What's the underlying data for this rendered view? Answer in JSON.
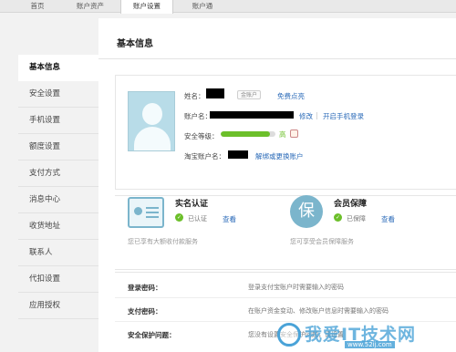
{
  "topnav": {
    "tabs": [
      {
        "label": "首页"
      },
      {
        "label": "账户资产"
      },
      {
        "label": "账户设置"
      },
      {
        "label": "账户通"
      }
    ]
  },
  "sidebar": {
    "items": [
      {
        "label": "基本信息"
      },
      {
        "label": "安全设置"
      },
      {
        "label": "手机设置"
      },
      {
        "label": "额度设置"
      },
      {
        "label": "支付方式"
      },
      {
        "label": "消息中心"
      },
      {
        "label": "收货地址"
      },
      {
        "label": "联系人"
      },
      {
        "label": "代扣设置"
      },
      {
        "label": "应用授权"
      }
    ]
  },
  "main": {
    "title": "基本信息",
    "profile": {
      "name_label": "姓名：",
      "cert_badge": "金账户",
      "free_light_link": "免费点亮",
      "account_label": "账户名：",
      "edit_link": "修改",
      "mobile_link": "开启手机登录",
      "security_label": "安全等级：",
      "security_level": "高",
      "security_progress": 0.9,
      "taobao_label": "淘宝账户名：",
      "unbind_link": "解绑或更换账户"
    },
    "realname": {
      "title": "实名认证",
      "status": "已认证",
      "view_link": "查看",
      "note": "您已享有大额收付款服务"
    },
    "protect": {
      "icon_char": "保",
      "title": "会员保障",
      "status": "已保障",
      "view_link": "查看",
      "note": "您可享受会员保障服务"
    },
    "rows": [
      {
        "key": "登录密码：",
        "value": "登录支付宝账户时需要输入的密码"
      },
      {
        "key": "支付密码：",
        "value": "在账户资金变动、修改账户信息时需要输入的密码"
      },
      {
        "key": "安全保护问题：",
        "value": "您没有设置安全保护问题，请设置"
      }
    ]
  },
  "watermark": {
    "text": "我爱IT技术网",
    "url": "www.52ij.com"
  }
}
